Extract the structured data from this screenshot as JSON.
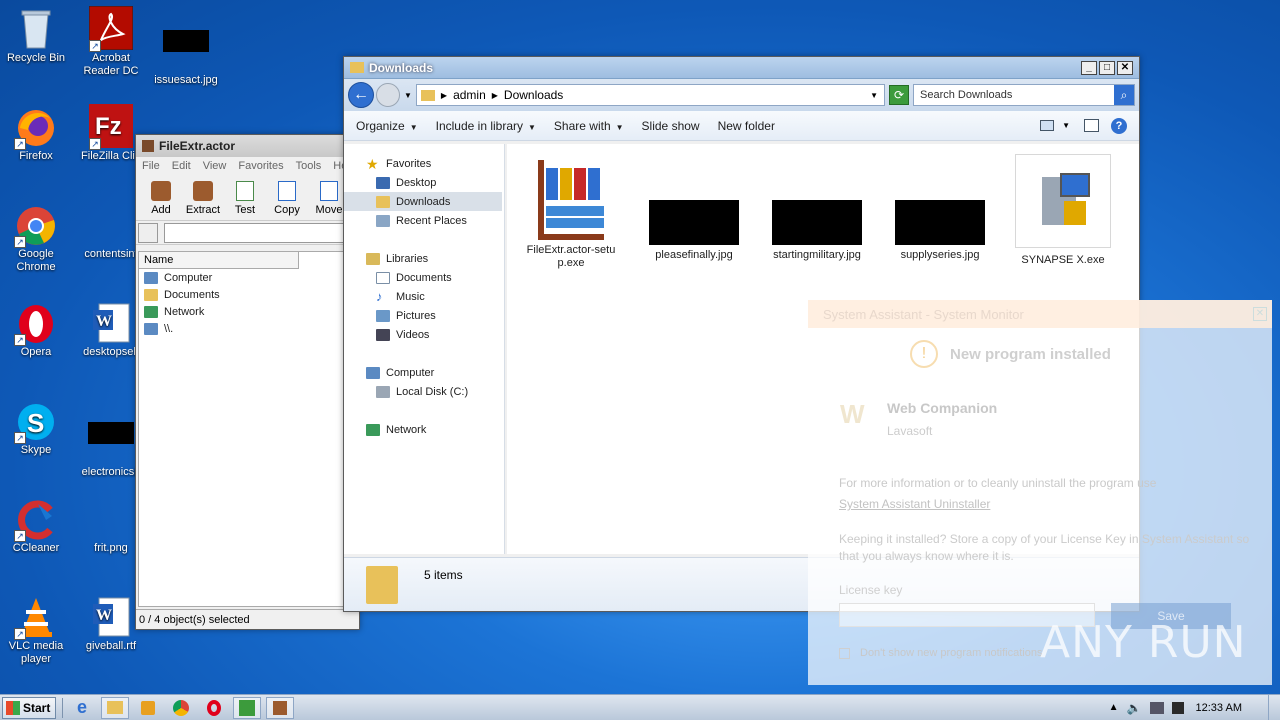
{
  "desktop": {
    "icons": [
      {
        "label": "Recycle Bin"
      },
      {
        "label": "Acrobat Reader DC"
      },
      {
        "label": "issuesact.jpg"
      },
      {
        "label": "Firefox"
      },
      {
        "label": "FileZilla Clie"
      },
      {
        "label": "Google Chrome"
      },
      {
        "label": "contentsint"
      },
      {
        "label": "Opera"
      },
      {
        "label": "desktopself"
      },
      {
        "label": "Skype"
      },
      {
        "label": "electronicsb"
      },
      {
        "label": "CCleaner"
      },
      {
        "label": "frit.png"
      },
      {
        "label": "VLC media player"
      },
      {
        "label": "giveball.rtf"
      }
    ]
  },
  "fileextr": {
    "title": "FileExtr.actor",
    "menu": [
      "File",
      "Edit",
      "View",
      "Favorites",
      "Tools",
      "Hel"
    ],
    "toolbar": [
      "Add",
      "Extract",
      "Test",
      "Copy",
      "Move"
    ],
    "column_name": "Name",
    "items": [
      "Computer",
      "Documents",
      "Network",
      "\\\\."
    ],
    "status": "0 / 4 object(s) selected"
  },
  "explorer": {
    "title": "Downloads",
    "breadcrumb": [
      "admin",
      "Downloads"
    ],
    "search_placeholder": "Search Downloads",
    "commands": [
      "Organize",
      "Include in library",
      "Share with",
      "Slide show",
      "New folder"
    ],
    "nav": {
      "favorites": "Favorites",
      "fav_items": [
        "Desktop",
        "Downloads",
        "Recent Places"
      ],
      "libraries": "Libraries",
      "lib_items": [
        "Documents",
        "Music",
        "Pictures",
        "Videos"
      ],
      "computer": "Computer",
      "comp_items": [
        "Local Disk (C:)"
      ],
      "network": "Network"
    },
    "files": [
      {
        "name": "FileExtr.actor-setup.exe"
      },
      {
        "name": "pleasefinally.jpg"
      },
      {
        "name": "startingmilitary.jpg"
      },
      {
        "name": "supplyseries.jpg"
      },
      {
        "name": "SYNAPSE X.exe"
      }
    ],
    "details": "5 items"
  },
  "popup": {
    "title": "System Assistant - System Monitor",
    "heading": "New program installed",
    "program_name": "Web Companion",
    "vendor": "Lavasoft",
    "info_text": "For more information or to cleanly uninstall the program use",
    "uninstall_link": "System Assistant Uninstaller",
    "keep_text": "Keeping it installed? Store a copy of your License Key in System Assistant so that you always know where it is.",
    "license_label": "License key",
    "save_label": "Save",
    "checkbox_label": "Don't show new program notifications"
  },
  "watermark": "ANY RUN",
  "taskbar": {
    "start_label": "Start",
    "clock": "12:33 AM"
  }
}
